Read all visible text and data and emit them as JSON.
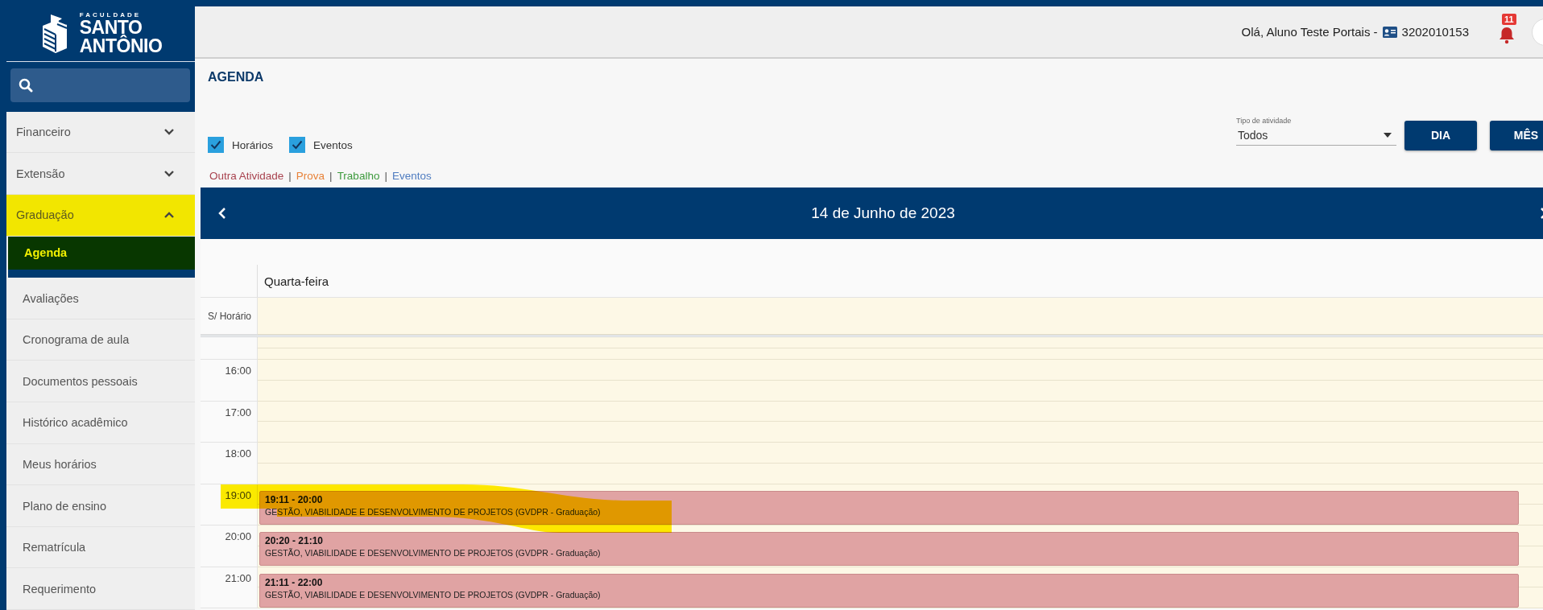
{
  "logo": {
    "overline": "FACULDADE",
    "line_1": "SANTO",
    "line_2": "ANTÔNIO"
  },
  "sidebar": {
    "items": [
      {
        "label": "Financeiro",
        "expanded": false,
        "highlighted": false
      },
      {
        "label": "Extensão",
        "expanded": false,
        "highlighted": false
      },
      {
        "label": "Graduação",
        "expanded": true,
        "highlighted": true,
        "children": [
          {
            "label": "Agenda",
            "selected": true
          },
          {
            "label": "Avaliações",
            "selected": false
          },
          {
            "label": "Cronograma de aula",
            "selected": false
          },
          {
            "label": "Documentos pessoais",
            "selected": false
          },
          {
            "label": "Histórico acadêmico",
            "selected": false
          },
          {
            "label": "Meus horários",
            "selected": false
          },
          {
            "label": "Plano de ensino",
            "selected": false
          },
          {
            "label": "Rematrícula",
            "selected": false
          },
          {
            "label": "Requerimento",
            "selected": false
          }
        ]
      }
    ]
  },
  "header": {
    "greeting": "Olá, Aluno Teste Portais -",
    "student_id": "3202010153",
    "notifications": "11"
  },
  "page_title": "AGENDA",
  "filters": [
    {
      "label": "Horários",
      "checked": true
    },
    {
      "label": "Eventos",
      "checked": true
    }
  ],
  "activity_type": {
    "label": "Tipo de atividade",
    "value": "Todos"
  },
  "view_buttons": [
    "DIA",
    "MÊS"
  ],
  "legend": [
    {
      "label": "Outra Atividade",
      "color": "#a8434f"
    },
    {
      "label": "Prova",
      "color": "#e8833a"
    },
    {
      "label": "Trabalho",
      "color": "#3d9a3d"
    },
    {
      "label": "Eventos",
      "color": "#4f7cc0"
    }
  ],
  "legend_separator": "|",
  "date_nav": {
    "title": "14 de Junho de 2023"
  },
  "day_view": {
    "day": "Quarta-feira",
    "all_day_label": "S/ Horário",
    "hours": [
      {
        "label": "16:00"
      },
      {
        "label": "17:00"
      },
      {
        "label": "18:00"
      },
      {
        "label": "19:00",
        "events": [
          {
            "time": "19:11 - 20:00",
            "title": "GESTÃO, VIABILIDADE E DESENVOLVIMENTO DE PROJETOS (GVDPR - Graduação)",
            "highlighted": true
          }
        ]
      },
      {
        "label": "20:00",
        "events": [
          {
            "time": "20:20 - 21:10",
            "title": "GESTÃO, VIABILIDADE E DESENVOLVIMENTO DE PROJETOS (GVDPR - Graduação)",
            "highlighted": false
          }
        ]
      },
      {
        "label": "21:00",
        "events": [
          {
            "time": "21:11 - 22:00",
            "title": "GESTÃO, VIABILIDADE E DESENVOLVIMENTO DE PROJETOS (GVDPR - Graduação)",
            "highlighted": false
          }
        ]
      }
    ]
  }
}
